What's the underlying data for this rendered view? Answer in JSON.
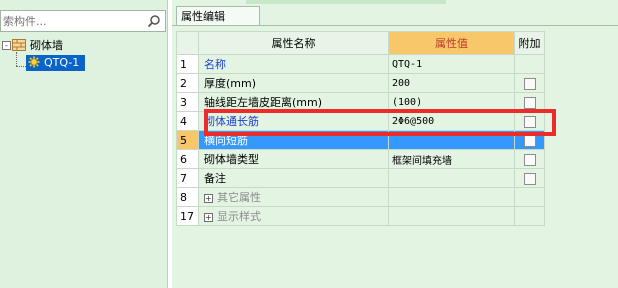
{
  "search": {
    "placeholder": "索构件..."
  },
  "tree": {
    "root": {
      "label": "砌体墙",
      "expander": "-"
    },
    "child": {
      "label": "QTQ-1"
    }
  },
  "tab": {
    "label": "属性编辑"
  },
  "grid": {
    "headers": {
      "name": "属性名称",
      "value": "属性值",
      "extra": "附加"
    },
    "rows": [
      {
        "idx": "1",
        "name": "名称",
        "value": "QTQ-1"
      },
      {
        "idx": "2",
        "name": "厚度(mm)",
        "value": "200"
      },
      {
        "idx": "3",
        "name": "轴线距左墙皮距离(mm)",
        "value": "(100)"
      },
      {
        "idx": "4",
        "name": "砌体通长筋",
        "value": "2Φ6@500"
      },
      {
        "idx": "5",
        "name": "横向短筋",
        "value": ""
      },
      {
        "idx": "6",
        "name": "砌体墙类型",
        "value": "框架间填充墙"
      },
      {
        "idx": "7",
        "name": "备注",
        "value": ""
      },
      {
        "idx": "8",
        "name": "其它属性",
        "value": "",
        "expander": "+"
      },
      {
        "idx": "17",
        "name": "显示样式",
        "value": "",
        "expander": "+"
      }
    ]
  },
  "colors": {
    "highlight": "#ee2b2b",
    "selection": "#3399ff",
    "value_header": "#f7c76a"
  }
}
